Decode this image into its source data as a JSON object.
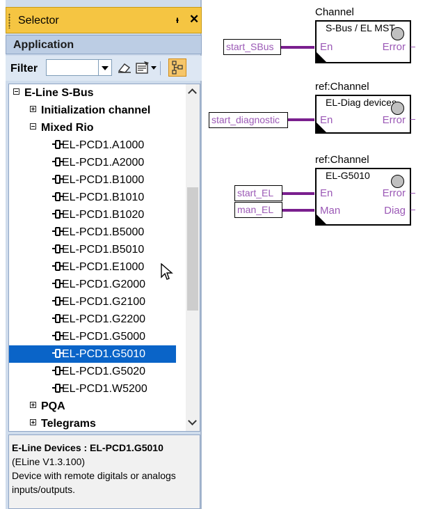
{
  "selector": {
    "title": "Selector",
    "pin_glyph": "ᵻ",
    "close_glyph": "✕",
    "section": "Application",
    "filter_label": "Filter",
    "filter_value": "",
    "tree": [
      {
        "label": "E-Line S-Bus",
        "level": 0,
        "expander": "minus",
        "bold": true
      },
      {
        "label": "Initialization channel",
        "level": 1,
        "expander": "plus",
        "bold": true
      },
      {
        "label": "Mixed Rio",
        "level": 1,
        "expander": "minus",
        "bold": true
      },
      {
        "label": "EL-PCD1.A1000",
        "level": 2,
        "icon": "device-icon"
      },
      {
        "label": "EL-PCD1.A2000",
        "level": 2,
        "icon": "device-icon"
      },
      {
        "label": "EL-PCD1.B1000",
        "level": 2,
        "icon": "device-icon"
      },
      {
        "label": "EL-PCD1.B1010",
        "level": 2,
        "icon": "device-icon"
      },
      {
        "label": "EL-PCD1.B1020",
        "level": 2,
        "icon": "device-icon"
      },
      {
        "label": "EL-PCD1.B5000",
        "level": 2,
        "icon": "device-icon"
      },
      {
        "label": "EL-PCD1.B5010",
        "level": 2,
        "icon": "device-icon"
      },
      {
        "label": "EL-PCD1.E1000",
        "level": 2,
        "icon": "device-icon"
      },
      {
        "label": "EL-PCD1.G2000",
        "level": 2,
        "icon": "device-icon"
      },
      {
        "label": "EL-PCD1.G2100",
        "level": 2,
        "icon": "device-icon"
      },
      {
        "label": "EL-PCD1.G2200",
        "level": 2,
        "icon": "device-icon"
      },
      {
        "label": "EL-PCD1.G5000",
        "level": 2,
        "icon": "device-icon"
      },
      {
        "label": "EL-PCD1.G5010",
        "level": 2,
        "icon": "device-icon",
        "selected": true
      },
      {
        "label": "EL-PCD1.G5020",
        "level": 2,
        "icon": "device-icon"
      },
      {
        "label": "EL-PCD1.W5200",
        "level": 2,
        "icon": "device-icon"
      },
      {
        "label": "PQA",
        "level": 1,
        "expander": "plus",
        "bold": true
      },
      {
        "label": "Telegrams",
        "level": 1,
        "expander": "plus",
        "bold": true
      }
    ],
    "info": {
      "heading": "E-Line Devices : EL-PCD1.G5010",
      "version": "(ELine V1.3.100)",
      "description": "Device with remote digitals or analogs inputs/outputs."
    }
  },
  "blocks": [
    {
      "label": "Channel",
      "name": "S-Bus / EL MST",
      "inputs": [
        "En"
      ],
      "outputs": [
        "Error"
      ],
      "signals": [
        "start_SBus"
      ]
    },
    {
      "label": "ref:Channel",
      "name": "EL-Diag devices",
      "inputs": [
        "En"
      ],
      "outputs": [
        "Error"
      ],
      "signals": [
        "start_diagnostic"
      ]
    },
    {
      "label": "ref:Channel",
      "name": "EL-G5010",
      "inputs": [
        "En",
        "Man"
      ],
      "outputs": [
        "Error",
        "Diag"
      ],
      "signals": [
        "start_EL",
        "man_EL"
      ]
    }
  ],
  "colors": {
    "title_bar": "#f5c542",
    "selection": "#0a64c8",
    "pin_text": "#9b59b6",
    "wire": "#7a1f8e"
  }
}
